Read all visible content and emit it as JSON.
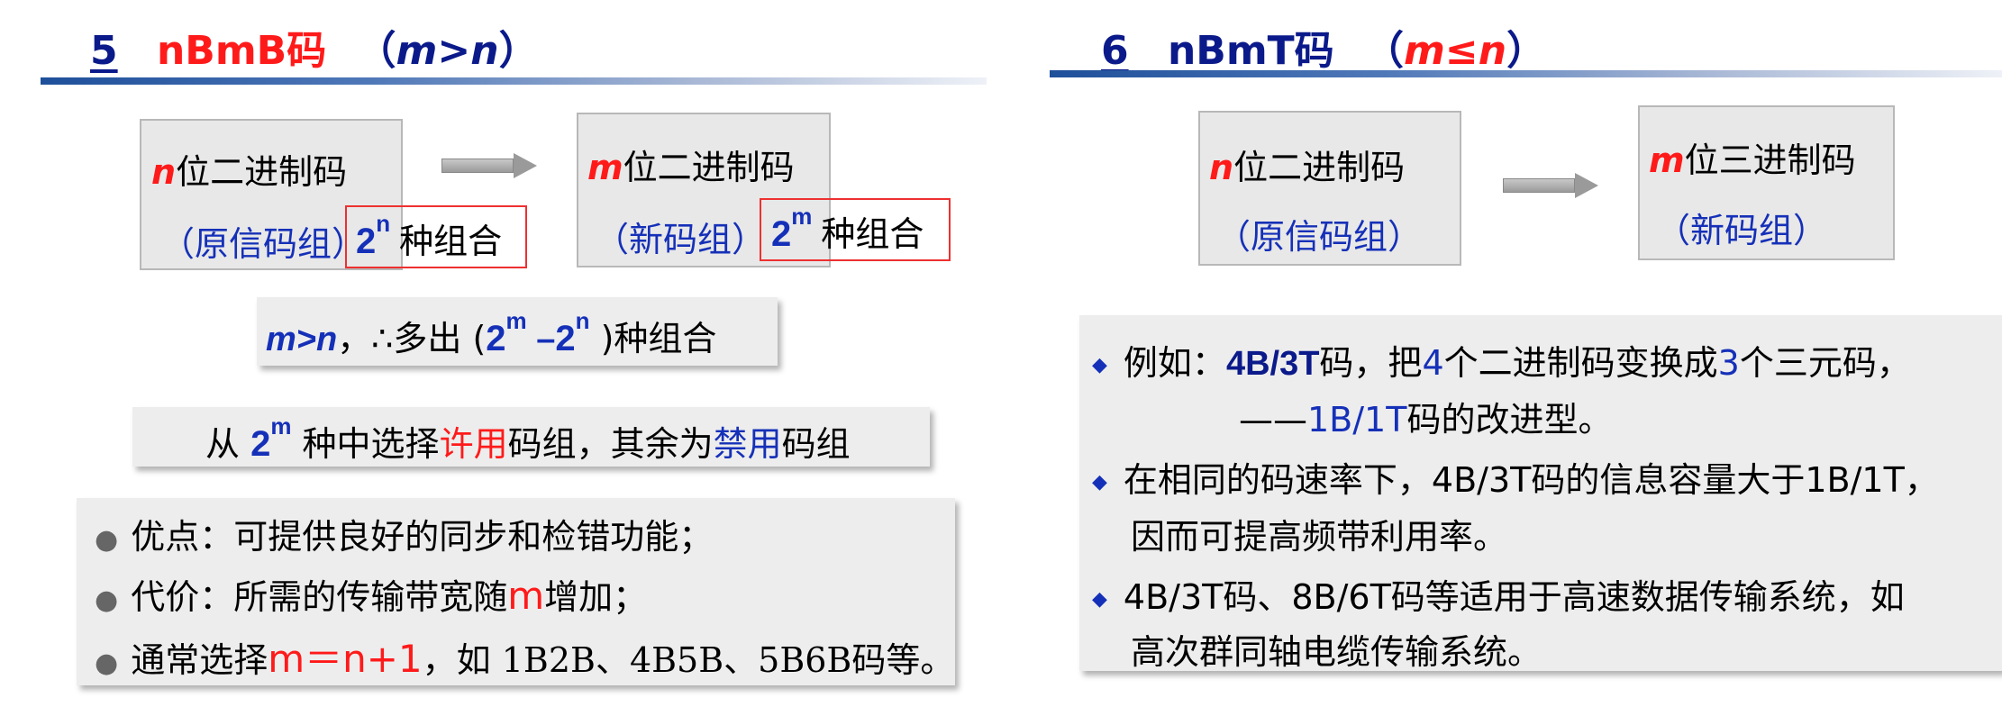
{
  "left": {
    "title": {
      "number": "5",
      "name": "nBmB码",
      "paren_open": "（",
      "cond_a": "m",
      "cond_op": ">",
      "cond_b": "n",
      "paren_close": "）"
    },
    "box_n": {
      "var": "n",
      "text": "位二进制码",
      "sub": "（原信码组）",
      "combo_base": "2",
      "combo_exp": "n",
      "combo_text": "种组合"
    },
    "box_m": {
      "var": "m",
      "text": "位二进制码",
      "sub": "（新码组）",
      "combo_base": "2",
      "combo_exp": "m",
      "combo_text": "种组合"
    },
    "extra": {
      "cond": "m>n",
      "mid": "，∴多出 (",
      "a_base": "2",
      "a_exp": "m",
      "minus": " –",
      "b_base": "2",
      "b_exp": "n",
      "end": " )种组合"
    },
    "choose": {
      "pre": "从 ",
      "base": "2",
      "exp": "m",
      "mid": " 种中选择",
      "allowed": "许用",
      "mid2": "码组，其余为",
      "forbidden": "禁用",
      "end": "码组"
    },
    "bullets": {
      "b1": "优点：可提供良好的同步和检错功能；",
      "b2_pre": "代价：所需的传输带宽随",
      "b2_var": "m",
      "b2_end": "增加；",
      "b3_pre": "通常选择",
      "b3_formula": "m＝n+1",
      "b3_end": "，如 1B2B、4B5B、5B6B码等。"
    }
  },
  "right": {
    "title": {
      "number": "6",
      "name": "nBmT码",
      "paren_open": "（",
      "cond": "m≤n",
      "paren_close": "）"
    },
    "box_n": {
      "var": "n",
      "text": "位二进制码",
      "sub": "（原信码组）"
    },
    "box_m": {
      "var": "m",
      "text": "位三进制码",
      "sub": "（新码组）"
    },
    "bullets": {
      "b1_pre": "例如：",
      "b1_code": "4B/3T",
      "b1_mid": "码，把",
      "b1_n1": "4",
      "b1_mid2": "个二进制码变换成",
      "b1_n2": "3",
      "b1_end": "个三元码，",
      "b1_line2_dash": "——",
      "b1_line2_code": "1B/1T",
      "b1_line2_end": "码的改进型。",
      "b2_line1": "在相同的码速率下，4B/3T码的信息容量大于1B/1T，",
      "b2_line2": "因而可提高频带利用率。",
      "b3_line1": "4B/3T码、8B/6T码等适用于高速数据传输系统，如",
      "b3_line2": "高次群同轴电缆传输系统。"
    }
  }
}
